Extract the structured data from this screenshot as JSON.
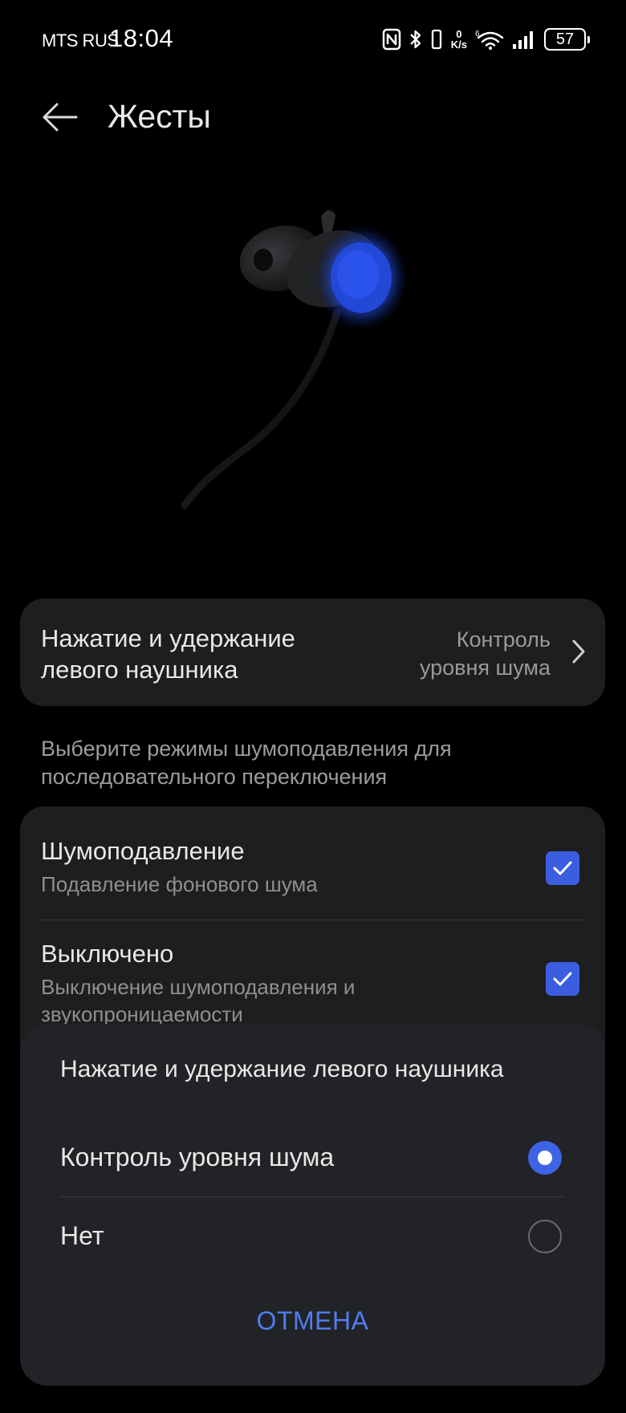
{
  "status_bar": {
    "carrier": "MTS RUS",
    "time": "18:04",
    "net_speed_value": "0",
    "net_speed_unit": "K/s",
    "battery": "57",
    "icons": [
      "nfc-icon",
      "bluetooth-icon",
      "vibrate-icon",
      "wifi-6-icon",
      "signal-icon",
      "battery-icon"
    ]
  },
  "header": {
    "title": "Жесты",
    "back_icon": "arrow-left-icon"
  },
  "gesture_setting": {
    "label": "Нажатие и удержание левого наушника",
    "value": "Контроль уровня шума",
    "icon": "chevron-right-icon"
  },
  "section_hint": "Выберите режимы шумоподавления для последовательного переключения",
  "modes": [
    {
      "title": "Шумоподавление",
      "description": "Подавление фонового шума",
      "checked": true
    },
    {
      "title": "Выключено",
      "description": "Выключение шумоподавления и звукопроницаемости",
      "checked": true
    }
  ],
  "dialog": {
    "title": "Нажатие и удержание левого наушника",
    "options": [
      {
        "label": "Контроль уровня шума",
        "selected": true
      },
      {
        "label": "Нет",
        "selected": false
      }
    ],
    "cancel_label": "ОТМЕНА"
  },
  "colors": {
    "accent": "#3e64e6",
    "link": "#4f7df2",
    "card_bg": "#1d1e20",
    "dialog_bg": "#222326"
  }
}
